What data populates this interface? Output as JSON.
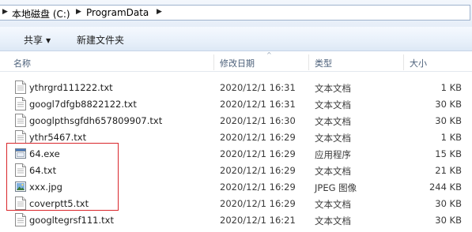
{
  "address": {
    "crumbs": [
      "本地磁盘 (C:)",
      "ProgramData"
    ]
  },
  "toolbar": {
    "share_label": "共享",
    "new_folder_label": "新建文件夹"
  },
  "columns": {
    "name": "名称",
    "date": "修改日期",
    "type": "类型",
    "size": "大小"
  },
  "files": [
    {
      "name": "ythrgrd111222.txt",
      "date": "2020/12/1 16:31",
      "type": "文本文档",
      "size": "1 KB",
      "icon": "text-file-icon"
    },
    {
      "name": "googl7dfgb8822122.txt",
      "date": "2020/12/1 16:31",
      "type": "文本文档",
      "size": "30 KB",
      "icon": "text-file-icon"
    },
    {
      "name": "googlpthsgfdh657809907.txt",
      "date": "2020/12/1 16:30",
      "type": "文本文档",
      "size": "30 KB",
      "icon": "text-file-icon"
    },
    {
      "name": "ythr5467.txt",
      "date": "2020/12/1 16:29",
      "type": "文本文档",
      "size": "1 KB",
      "icon": "text-file-icon"
    },
    {
      "name": "64.exe",
      "date": "2020/12/1 16:29",
      "type": "应用程序",
      "size": "15 KB",
      "icon": "application-icon"
    },
    {
      "name": "64.txt",
      "date": "2020/12/1 16:29",
      "type": "文本文档",
      "size": "21 KB",
      "icon": "text-file-icon"
    },
    {
      "name": "xxx.jpg",
      "date": "2020/12/1 16:29",
      "type": "JPEG 图像",
      "size": "244 KB",
      "icon": "image-file-icon"
    },
    {
      "name": "coverptt5.txt",
      "date": "2020/12/1 16:29",
      "type": "文本文档",
      "size": "30 KB",
      "icon": "text-file-icon"
    },
    {
      "name": "googltegrsf111.txt",
      "date": "2020/12/1 16:21",
      "type": "文本文档",
      "size": "30 KB",
      "icon": "text-file-icon"
    }
  ],
  "highlight_color": "#d9262b"
}
